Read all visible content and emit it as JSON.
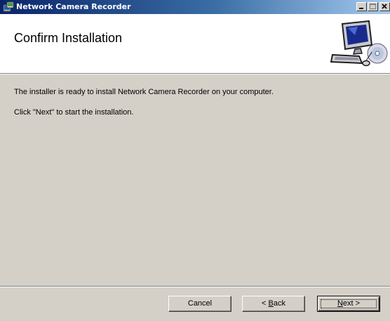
{
  "window": {
    "title": "Network Camera Recorder",
    "titlebar_color_start": "#0a246a",
    "titlebar_color_end": "#a6caf0"
  },
  "header": {
    "title": "Confirm Installation",
    "graphic_icon": "computer-disc-icon"
  },
  "body": {
    "line1": "The installer is ready to install Network Camera Recorder on your computer.",
    "line2": "Click \"Next\" to start the installation."
  },
  "buttons": {
    "cancel_label": "Cancel",
    "back_prefix": "< ",
    "back_mnemonic": "B",
    "back_rest": "ack",
    "next_mnemonic": "N",
    "next_rest": "ext >"
  },
  "caption_buttons": {
    "minimize_icon": "minimize-icon",
    "maximize_icon": "maximize-icon",
    "close_icon": "close-icon"
  }
}
